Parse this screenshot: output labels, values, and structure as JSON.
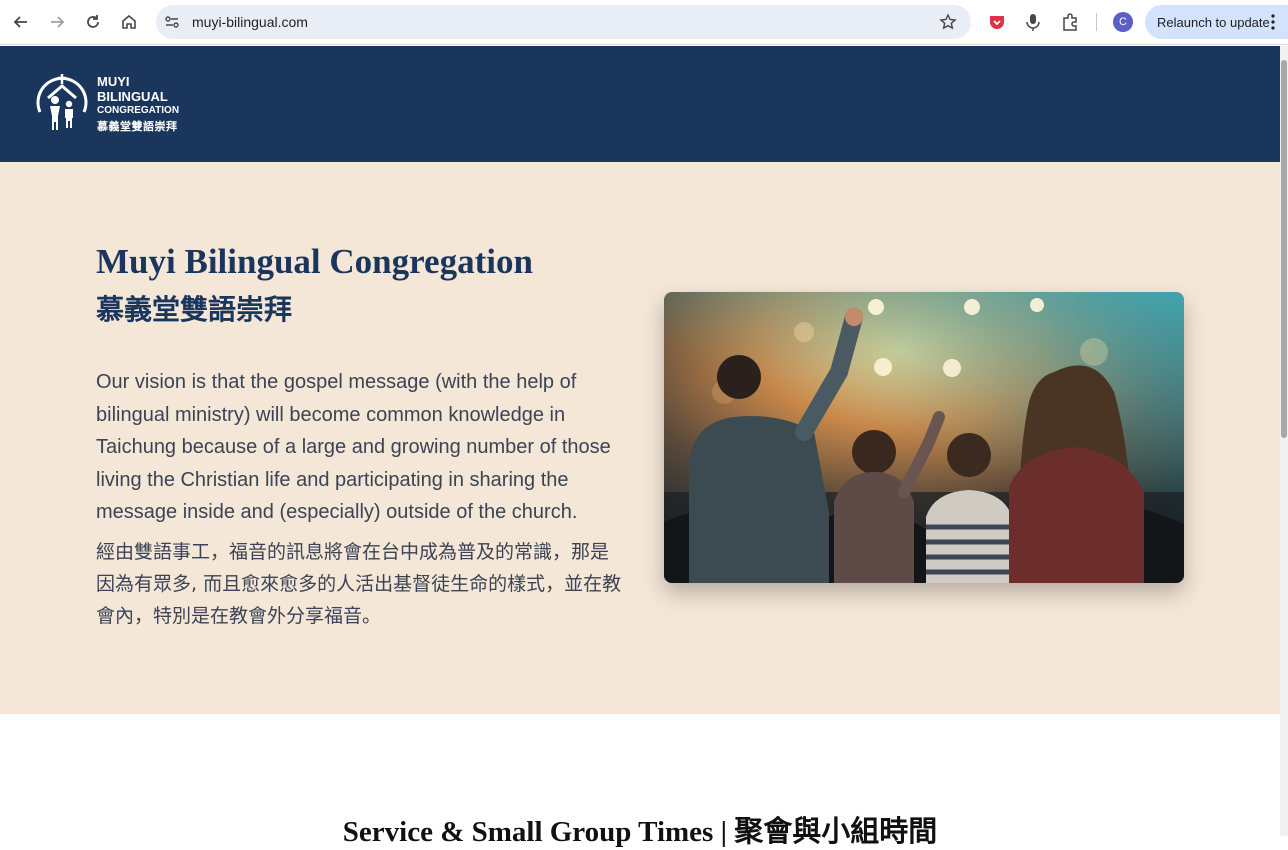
{
  "browser": {
    "url": "muyi-bilingual.com",
    "profile_initial": "C",
    "relaunch_label": "Relaunch to update",
    "icons": [
      "back-icon",
      "forward-icon",
      "reload-icon",
      "home-icon",
      "site-info-icon",
      "star-icon",
      "pocket-icon",
      "microphone-icon",
      "extensions-icon",
      "more-vert-icon"
    ]
  },
  "header": {
    "logo_line1": "MUYI",
    "logo_line2": "BILINGUAL",
    "logo_line3": "CONGREGATION",
    "logo_line4": "慕義堂雙語崇拜",
    "background": "#1b365d"
  },
  "hero": {
    "title": "Muyi Bilingual Congregation",
    "title_zh": "慕義堂雙語崇拜",
    "vision_en": "Our vision is that the gospel message (with the help of bilingual ministry) will become common knowledge in Taichung because of a large and growing number of those living the Christian life and participating in sharing the message inside and (especially) outside of the church.",
    "vision_zh": "經由雙語事工，福音的訊息將會在台中成為普及的常識，那是因為有眾多, 而且愈來愈多的人活出基督徒生命的樣式，並在教會內，特別是在教會外分享福音。",
    "background": "#f4e7d8"
  },
  "schedule": {
    "title": "Service & Small Group Times | 聚會與小組時間"
  }
}
